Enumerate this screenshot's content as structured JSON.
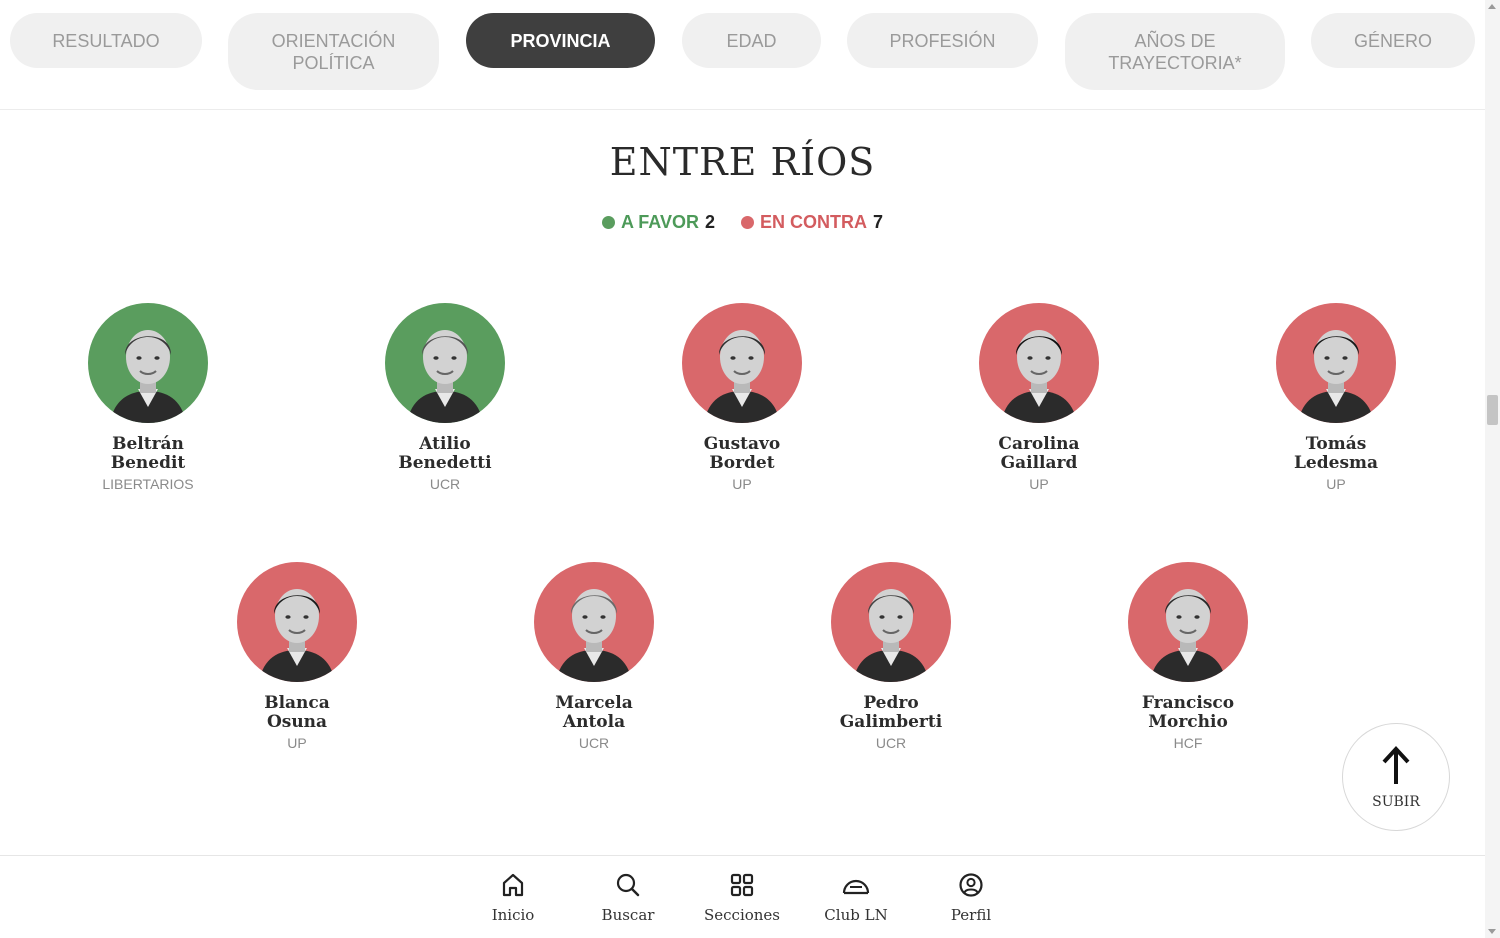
{
  "tabs": [
    {
      "label": "RESULTADO",
      "active": false
    },
    {
      "label": "ORIENTACIÓN POLÍTICA",
      "active": false
    },
    {
      "label": "PROVINCIA",
      "active": true
    },
    {
      "label": "EDAD",
      "active": false
    },
    {
      "label": "PROFESIÓN",
      "active": false
    },
    {
      "label": "AÑOS DE TRAYECTORIA*",
      "active": false
    },
    {
      "label": "GÉNERO",
      "active": false
    }
  ],
  "province": "ENTRE RÍOS",
  "tally": {
    "favor_label": "A FAVOR",
    "favor_count": "2",
    "contra_label": "EN CONTRA",
    "contra_count": "7",
    "favor_color": "#5a9d5e",
    "contra_color": "#d9686b"
  },
  "legislators": [
    {
      "first": "Beltrán",
      "last": "Benedit",
      "party": "LIBERTARIOS",
      "vote": "favor"
    },
    {
      "first": "Atilio",
      "last": "Benedetti",
      "party": "UCR",
      "vote": "favor"
    },
    {
      "first": "Gustavo",
      "last": "Bordet",
      "party": "UP",
      "vote": "contra"
    },
    {
      "first": "Carolina",
      "last": "Gaillard",
      "party": "UP",
      "vote": "contra"
    },
    {
      "first": "Tomás",
      "last": "Ledesma",
      "party": "UP",
      "vote": "contra"
    },
    {
      "first": "Blanca",
      "last": "Osuna",
      "party": "UP",
      "vote": "contra"
    },
    {
      "first": "Marcela",
      "last": "Antola",
      "party": "UCR",
      "vote": "contra"
    },
    {
      "first": "Pedro",
      "last": "Galimberti",
      "party": "UCR",
      "vote": "contra"
    },
    {
      "first": "Francisco",
      "last": "Morchio",
      "party": "HCF",
      "vote": "contra"
    }
  ],
  "subir_label": "SUBIR",
  "bottom_nav": [
    {
      "label": "Inicio",
      "icon": "home-icon"
    },
    {
      "label": "Buscar",
      "icon": "search-icon"
    },
    {
      "label": "Secciones",
      "icon": "grid-icon"
    },
    {
      "label": "Club LN",
      "icon": "club-icon"
    },
    {
      "label": "Perfil",
      "icon": "profile-icon"
    }
  ]
}
